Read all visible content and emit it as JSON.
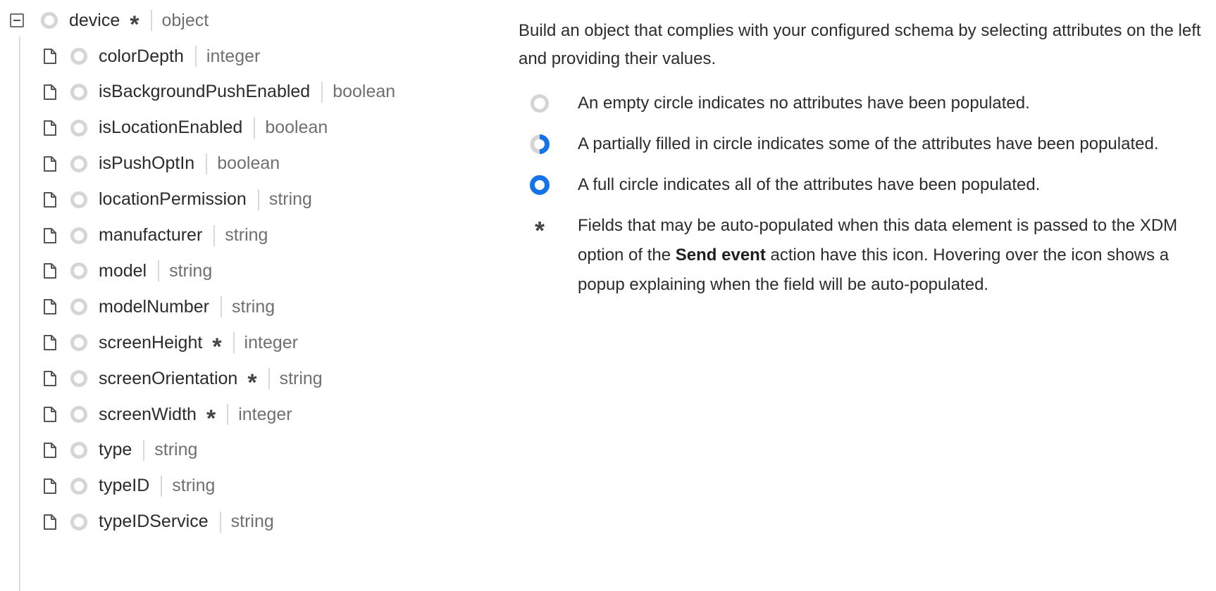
{
  "tree": {
    "root": {
      "name": "device",
      "type": "object",
      "auto_populated": true,
      "expanded": true
    },
    "children": [
      {
        "name": "colorDepth",
        "type": "integer",
        "auto": false
      },
      {
        "name": "isBackgroundPushEnabled",
        "type": "boolean",
        "auto": false
      },
      {
        "name": "isLocationEnabled",
        "type": "boolean",
        "auto": false
      },
      {
        "name": "isPushOptIn",
        "type": "boolean",
        "auto": false
      },
      {
        "name": "locationPermission",
        "type": "string",
        "auto": false
      },
      {
        "name": "manufacturer",
        "type": "string",
        "auto": false
      },
      {
        "name": "model",
        "type": "string",
        "auto": false
      },
      {
        "name": "modelNumber",
        "type": "string",
        "auto": false
      },
      {
        "name": "screenHeight",
        "type": "integer",
        "auto": true
      },
      {
        "name": "screenOrientation",
        "type": "string",
        "auto": true
      },
      {
        "name": "screenWidth",
        "type": "integer",
        "auto": true
      },
      {
        "name": "type",
        "type": "string",
        "auto": false
      },
      {
        "name": "typeID",
        "type": "string",
        "auto": false
      },
      {
        "name": "typeIDService",
        "type": "string",
        "auto": false
      }
    ]
  },
  "info": {
    "intro": "Build an object that complies with your configured schema by selecting attributes on the left and providing their values.",
    "legend": {
      "empty": "An empty circle indicates no attributes have been populated.",
      "partial": "A partially filled in circle indicates some of the attributes have been populated.",
      "full": "A full circle indicates all of the attributes have been populated.",
      "auto_before": "Fields that may be auto-populated when this data element is passed to the XDM option of the ",
      "auto_bold": "Send event",
      "auto_after": " action have this icon. Hovering over the icon shows a popup explaining when the field will be auto-populated."
    }
  },
  "icons": {
    "expander": "collapse-minus-icon",
    "child": "document-icon",
    "status": "empty-circle-icon",
    "auto": "asterisk-icon"
  },
  "colors": {
    "accent": "#1473e6",
    "circle_empty": "#d5d5d5",
    "type_text": "#707070"
  }
}
